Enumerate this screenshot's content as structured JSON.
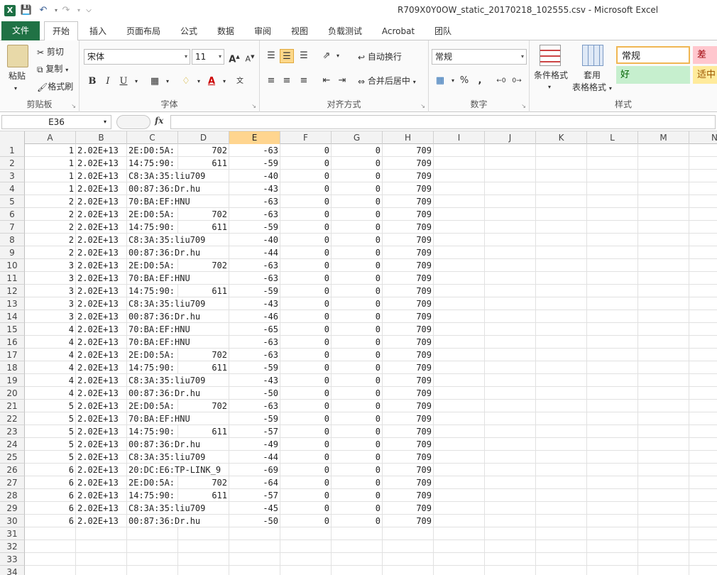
{
  "window": {
    "title": "R709X0Y0OW_static_20170218_102555.csv - Microsoft Excel",
    "app_icon": "X",
    "accent": "#207245"
  },
  "tabs": [
    "文件",
    "开始",
    "插入",
    "页面布局",
    "公式",
    "数据",
    "审阅",
    "视图",
    "负载测试",
    "Acrobat",
    "团队"
  ],
  "ribbon": {
    "clipboard": {
      "paste": "粘贴",
      "cut": "剪切",
      "copy": "复制",
      "format_painter": "格式刷",
      "label": "剪贴板"
    },
    "font": {
      "name": "宋体",
      "size": "11",
      "bold": "B",
      "italic": "I",
      "underline": "U",
      "label": "字体"
    },
    "alignment": {
      "wrap": "自动换行",
      "merge": "合并后居中",
      "label": "对齐方式"
    },
    "number": {
      "format": "常规",
      "percent": "%",
      "comma": ",",
      "label": "数字"
    },
    "styles": {
      "conditional": "条件格式",
      "table_1": "套用",
      "table_2": "表格格式",
      "normal": "常规",
      "bad": "差",
      "good": "好",
      "neutral": "适中",
      "label": "样式"
    }
  },
  "formula_bar": {
    "name_box": "E36",
    "fx": "fx",
    "formula": ""
  },
  "columns": [
    "A",
    "B",
    "C",
    "D",
    "E",
    "F",
    "G",
    "H",
    "I",
    "J",
    "K",
    "L",
    "M",
    "N"
  ],
  "selected_column": "E",
  "rows": [
    [
      "1",
      "2.02E+13",
      "2E:D0:5A:",
      "702",
      "-63",
      "0",
      "0",
      "709"
    ],
    [
      "1",
      "2.02E+13",
      "14:75:90:",
      "611",
      "-59",
      "0",
      "0",
      "709"
    ],
    [
      "1",
      "2.02E+13",
      "C8:3A:35:liu709",
      "",
      "-40",
      "0",
      "0",
      "709"
    ],
    [
      "1",
      "2.02E+13",
      "00:87:36:Dr.hu",
      "",
      "-43",
      "0",
      "0",
      "709"
    ],
    [
      "2",
      "2.02E+13",
      "70:BA:EF:HNU",
      "",
      "-63",
      "0",
      "0",
      "709"
    ],
    [
      "2",
      "2.02E+13",
      "2E:D0:5A:",
      "702",
      "-63",
      "0",
      "0",
      "709"
    ],
    [
      "2",
      "2.02E+13",
      "14:75:90:",
      "611",
      "-59",
      "0",
      "0",
      "709"
    ],
    [
      "2",
      "2.02E+13",
      "C8:3A:35:liu709",
      "",
      "-40",
      "0",
      "0",
      "709"
    ],
    [
      "2",
      "2.02E+13",
      "00:87:36:Dr.hu",
      "",
      "-44",
      "0",
      "0",
      "709"
    ],
    [
      "3",
      "2.02E+13",
      "2E:D0:5A:",
      "702",
      "-63",
      "0",
      "0",
      "709"
    ],
    [
      "3",
      "2.02E+13",
      "70:BA:EF:HNU",
      "",
      "-63",
      "0",
      "0",
      "709"
    ],
    [
      "3",
      "2.02E+13",
      "14:75:90:",
      "611",
      "-59",
      "0",
      "0",
      "709"
    ],
    [
      "3",
      "2.02E+13",
      "C8:3A:35:liu709",
      "",
      "-43",
      "0",
      "0",
      "709"
    ],
    [
      "3",
      "2.02E+13",
      "00:87:36:Dr.hu",
      "",
      "-46",
      "0",
      "0",
      "709"
    ],
    [
      "4",
      "2.02E+13",
      "70:BA:EF:HNU",
      "",
      "-65",
      "0",
      "0",
      "709"
    ],
    [
      "4",
      "2.02E+13",
      "70:BA:EF:HNU",
      "",
      "-63",
      "0",
      "0",
      "709"
    ],
    [
      "4",
      "2.02E+13",
      "2E:D0:5A:",
      "702",
      "-63",
      "0",
      "0",
      "709"
    ],
    [
      "4",
      "2.02E+13",
      "14:75:90:",
      "611",
      "-59",
      "0",
      "0",
      "709"
    ],
    [
      "4",
      "2.02E+13",
      "C8:3A:35:liu709",
      "",
      "-43",
      "0",
      "0",
      "709"
    ],
    [
      "4",
      "2.02E+13",
      "00:87:36:Dr.hu",
      "",
      "-50",
      "0",
      "0",
      "709"
    ],
    [
      "5",
      "2.02E+13",
      "2E:D0:5A:",
      "702",
      "-63",
      "0",
      "0",
      "709"
    ],
    [
      "5",
      "2.02E+13",
      "70:BA:EF:HNU",
      "",
      "-59",
      "0",
      "0",
      "709"
    ],
    [
      "5",
      "2.02E+13",
      "14:75:90:",
      "611",
      "-57",
      "0",
      "0",
      "709"
    ],
    [
      "5",
      "2.02E+13",
      "00:87:36:Dr.hu",
      "",
      "-49",
      "0",
      "0",
      "709"
    ],
    [
      "5",
      "2.02E+13",
      "C8:3A:35:liu709",
      "",
      "-44",
      "0",
      "0",
      "709"
    ],
    [
      "6",
      "2.02E+13",
      "20:DC:E6:TP-LINK_9",
      "",
      "-69",
      "0",
      "0",
      "709"
    ],
    [
      "6",
      "2.02E+13",
      "2E:D0:5A:",
      "702",
      "-64",
      "0",
      "0",
      "709"
    ],
    [
      "6",
      "2.02E+13",
      "14:75:90:",
      "611",
      "-57",
      "0",
      "0",
      "709"
    ],
    [
      "6",
      "2.02E+13",
      "C8:3A:35:liu709",
      "",
      "-45",
      "0",
      "0",
      "709"
    ],
    [
      "6",
      "2.02E+13",
      "00:87:36:Dr.hu",
      "",
      "-50",
      "0",
      "0",
      "709"
    ]
  ],
  "empty_rows": [
    "31",
    "32",
    "33",
    "34"
  ]
}
